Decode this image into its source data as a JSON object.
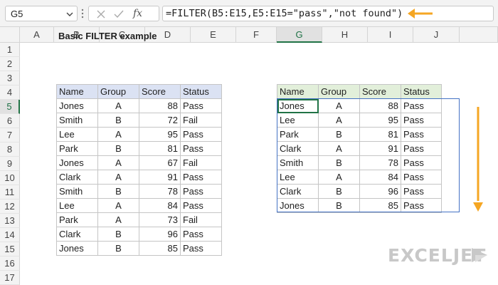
{
  "formula_bar": {
    "name_box": "G5",
    "formula": "=FILTER(B5:E15,E5:E15=\"pass\",\"not found\")",
    "fx_label": "fx"
  },
  "columns": [
    "A",
    "B",
    "C",
    "D",
    "E",
    "F",
    "G",
    "H",
    "I",
    "J"
  ],
  "rows": [
    "1",
    "2",
    "3",
    "4",
    "5",
    "6",
    "7",
    "8",
    "9",
    "10",
    "11",
    "12",
    "13",
    "14",
    "15",
    "16",
    "17"
  ],
  "selected_column": "G",
  "selected_row": "5",
  "title": "Basic FILTER example",
  "source_table": {
    "headers": [
      "Name",
      "Group",
      "Score",
      "Status"
    ],
    "rows": [
      [
        "Jones",
        "A",
        "88",
        "Pass"
      ],
      [
        "Smith",
        "B",
        "72",
        "Fail"
      ],
      [
        "Lee",
        "A",
        "95",
        "Pass"
      ],
      [
        "Park",
        "B",
        "81",
        "Pass"
      ],
      [
        "Jones",
        "A",
        "67",
        "Fail"
      ],
      [
        "Clark",
        "A",
        "91",
        "Pass"
      ],
      [
        "Smith",
        "B",
        "78",
        "Pass"
      ],
      [
        "Lee",
        "A",
        "84",
        "Pass"
      ],
      [
        "Park",
        "A",
        "73",
        "Fail"
      ],
      [
        "Clark",
        "B",
        "96",
        "Pass"
      ],
      [
        "Jones",
        "B",
        "85",
        "Pass"
      ]
    ]
  },
  "result_table": {
    "headers": [
      "Name",
      "Group",
      "Score",
      "Status"
    ],
    "rows": [
      [
        "Jones",
        "A",
        "88",
        "Pass"
      ],
      [
        "Lee",
        "A",
        "95",
        "Pass"
      ],
      [
        "Park",
        "B",
        "81",
        "Pass"
      ],
      [
        "Clark",
        "A",
        "91",
        "Pass"
      ],
      [
        "Smith",
        "B",
        "78",
        "Pass"
      ],
      [
        "Lee",
        "A",
        "84",
        "Pass"
      ],
      [
        "Clark",
        "B",
        "96",
        "Pass"
      ],
      [
        "Jones",
        "B",
        "85",
        "Pass"
      ]
    ]
  },
  "logo": "EXCELJET",
  "colors": {
    "accent_arrow": "#f5a623",
    "selection": "#217346",
    "spill_border": "#4472c4",
    "source_header": "#dbe2f3",
    "result_header": "#e2efda"
  }
}
